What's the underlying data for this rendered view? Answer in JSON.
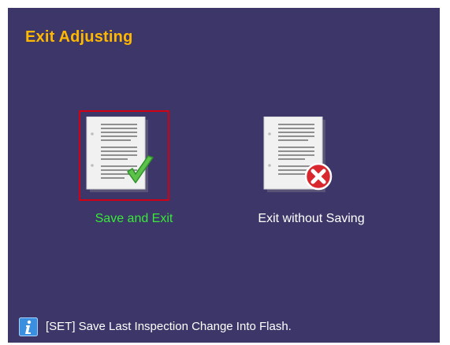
{
  "dialog": {
    "title": "Exit Adjusting"
  },
  "options": {
    "save": {
      "label": "Save and Exit",
      "icon": "document-check-icon",
      "selected": true
    },
    "discard": {
      "label": "Exit without Saving",
      "icon": "document-error-icon",
      "selected": false
    }
  },
  "footer": {
    "icon": "info-icon",
    "text": "[SET] Save Last Inspection Change Into Flash."
  },
  "colors": {
    "background": "#3c3768",
    "title": "#ffb800",
    "selected_label": "#39e83a",
    "selection_border": "#d10014",
    "label": "#ffffff"
  }
}
